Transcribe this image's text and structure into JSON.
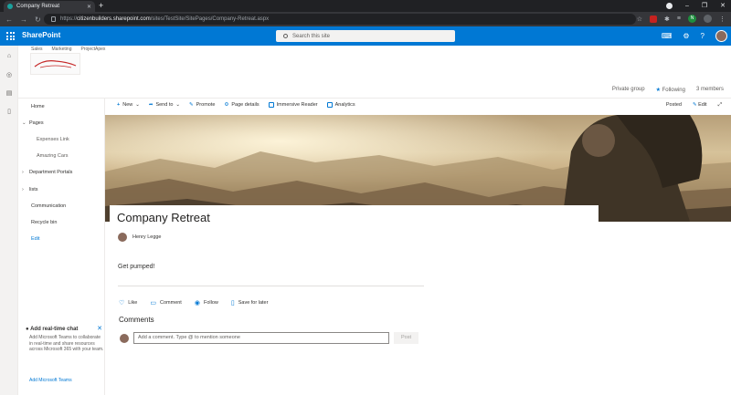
{
  "browser": {
    "tab_title": "Company Retreat",
    "url_host": "citizenbuilders.sharepoint.com",
    "url_path": "/sites/TestSite/SitePages/Company-Retreat.aspx",
    "url_scheme": "https://"
  },
  "suite": {
    "app_name": "SharePoint",
    "search_placeholder": "Search this site"
  },
  "hub": {
    "items": [
      "Sales",
      "Marketing",
      "ProjectApex"
    ]
  },
  "site": {
    "privacy": "Private group",
    "following": "Following",
    "members": "3 members"
  },
  "leftnav": {
    "items": [
      {
        "label": "Home"
      },
      {
        "label": "Pages"
      },
      {
        "label": "Expenses Link"
      },
      {
        "label": "Amazing Cars"
      },
      {
        "label": "Department Portals"
      },
      {
        "label": "lists"
      },
      {
        "label": "Communication"
      },
      {
        "label": "Recycle bin"
      },
      {
        "label": "Edit"
      }
    ]
  },
  "commandbar": {
    "new": "New",
    "send_to": "Send to",
    "promote": "Promote",
    "page_details": "Page details",
    "immersive_reader": "Immersive Reader",
    "analytics": "Analytics",
    "status": "Posted",
    "edit": "Edit"
  },
  "page": {
    "title": "Company Retreat",
    "author": "Henry Legge",
    "body": "Get pumped!"
  },
  "social": {
    "like": "Like",
    "comment": "Comment",
    "follow": "Follow",
    "save": "Save for later"
  },
  "comments": {
    "heading": "Comments",
    "placeholder": "Add a comment. Type @ to mention someone",
    "post": "Post"
  },
  "chat": {
    "title": "Add real-time chat",
    "text": "Add Microsoft Teams to collaborate in real-time and share resources across Microsoft 365 with your team.",
    "link": "Add Microsoft Teams"
  },
  "colors": {
    "suite_bar": "#0078d4",
    "accent": "#0078d4"
  }
}
